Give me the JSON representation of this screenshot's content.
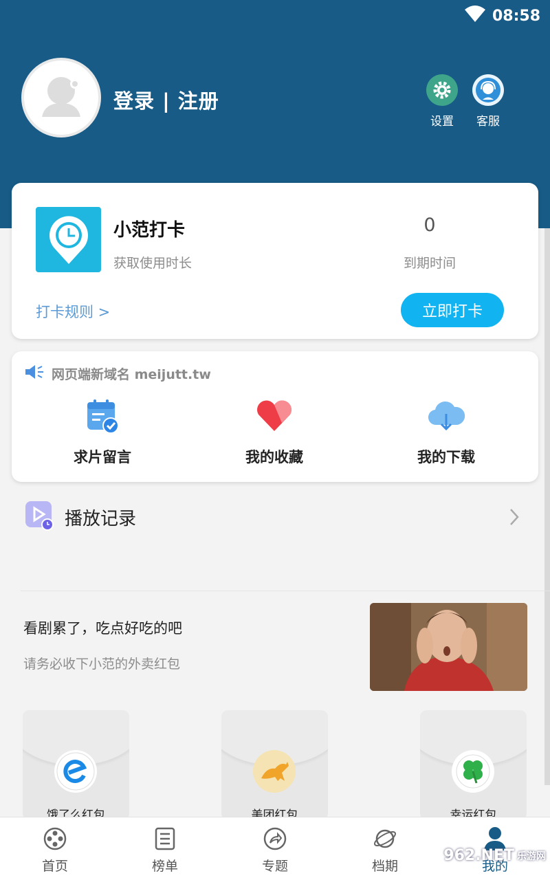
{
  "status_bar": {
    "time": "08:58",
    "wifi_icon": "wifi-icon"
  },
  "header": {
    "login_text": "登录 | 注册",
    "settings_label": "设置",
    "support_label": "客服",
    "bg_color": "#175b86"
  },
  "checkin_card": {
    "title": "小范打卡",
    "subtitle": "获取使用时长",
    "count": "0",
    "count_label": "到期时间",
    "rules_link": "打卡规则 >",
    "button_label": "立即打卡",
    "accent_color": "#11b4f0"
  },
  "quick_actions": {
    "notice": "网页端新域名 meijutt.tw",
    "items": [
      {
        "label": "求片留言",
        "icon": "calendar-check-icon"
      },
      {
        "label": "我的收藏",
        "icon": "heart-icon"
      },
      {
        "label": "我的下载",
        "icon": "cloud-download-icon"
      }
    ]
  },
  "history": {
    "label": "播放记录"
  },
  "promo": {
    "title": "看剧累了，吃点好吃的吧",
    "subtitle": "请务必收下小范的外卖红包",
    "image": "shocked-man-photo"
  },
  "red_packets": [
    {
      "label": "饿了么红包",
      "icon": "eleme-logo-icon"
    },
    {
      "label": "美团红包",
      "icon": "kangaroo-logo-icon"
    },
    {
      "label": "幸运红包",
      "icon": "clover-logo-icon"
    }
  ],
  "tabs": [
    {
      "label": "首页",
      "icon": "film-reel-icon"
    },
    {
      "label": "榜单",
      "icon": "list-icon"
    },
    {
      "label": "专题",
      "icon": "share-arrow-icon"
    },
    {
      "label": "档期",
      "icon": "planet-icon"
    },
    {
      "label": "我的",
      "icon": "person-icon"
    }
  ],
  "watermark": {
    "text": "962.NET",
    "sub": "乐游网"
  }
}
